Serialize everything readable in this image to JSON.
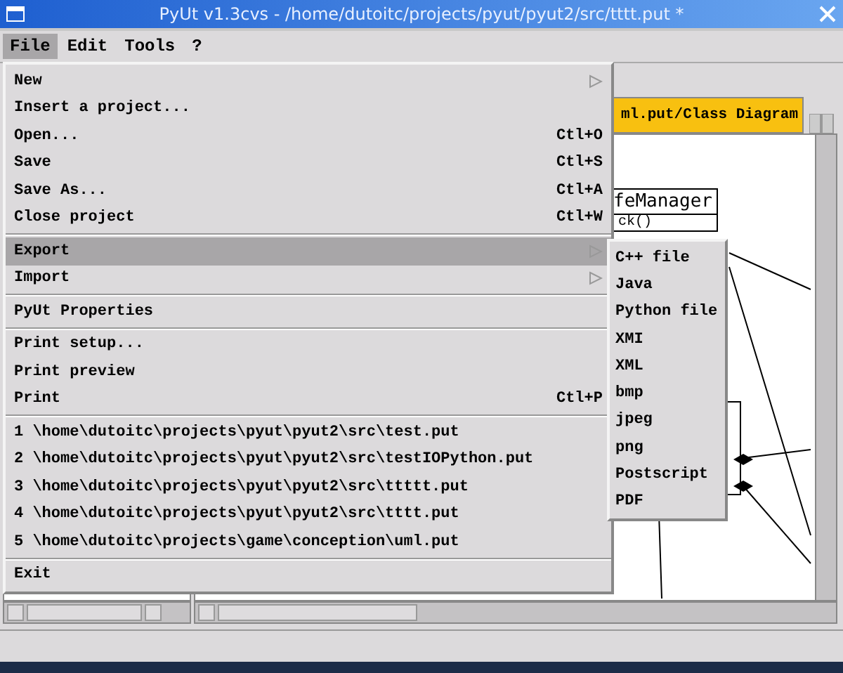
{
  "window": {
    "title": "PyUt v1.3cvs - /home/dutoitc/projects/pyut/pyut2/src/tttt.put *"
  },
  "menubar": [
    {
      "label": "File",
      "selected": true
    },
    {
      "label": "Edit",
      "selected": false
    },
    {
      "label": "Tools",
      "selected": false
    },
    {
      "label": "?",
      "selected": false
    }
  ],
  "file_menu": [
    {
      "kind": "submenu",
      "label": "New",
      "selected": false
    },
    {
      "kind": "item",
      "label": "Insert a project...",
      "selected": false
    },
    {
      "kind": "item",
      "label": "Open...",
      "shortcut": "Ctl+O",
      "selected": false
    },
    {
      "kind": "item",
      "label": "Save",
      "shortcut": "Ctl+S",
      "selected": false
    },
    {
      "kind": "item",
      "label": "Save As...",
      "shortcut": "Ctl+A",
      "selected": false
    },
    {
      "kind": "item",
      "label": "Close project",
      "shortcut": "Ctl+W",
      "selected": false
    },
    {
      "kind": "separator"
    },
    {
      "kind": "submenu",
      "label": "Export",
      "selected": true
    },
    {
      "kind": "submenu",
      "label": "Import",
      "selected": false
    },
    {
      "kind": "separator"
    },
    {
      "kind": "item",
      "label": "PyUt Properties",
      "selected": false
    },
    {
      "kind": "separator"
    },
    {
      "kind": "item",
      "label": "Print setup...",
      "selected": false
    },
    {
      "kind": "item",
      "label": "Print preview",
      "selected": false
    },
    {
      "kind": "item",
      "label": "Print",
      "shortcut": "Ctl+P",
      "selected": false
    },
    {
      "kind": "separator"
    },
    {
      "kind": "item",
      "label": "1 \\home\\dutoitc\\projects\\pyut\\pyut2\\src\\test.put",
      "selected": false
    },
    {
      "kind": "item",
      "label": "2 \\home\\dutoitc\\projects\\pyut\\pyut2\\src\\testIOPython.put",
      "selected": false
    },
    {
      "kind": "item",
      "label": "3 \\home\\dutoitc\\projects\\pyut\\pyut2\\src\\ttttt.put",
      "selected": false
    },
    {
      "kind": "item",
      "label": "4 \\home\\dutoitc\\projects\\pyut\\pyut2\\src\\tttt.put",
      "selected": false
    },
    {
      "kind": "item",
      "label": "5 \\home\\dutoitc\\projects\\game\\conception\\uml.put",
      "selected": false
    },
    {
      "kind": "separator"
    },
    {
      "kind": "item",
      "label": "Exit",
      "selected": false
    }
  ],
  "export_menu": [
    "C++ file",
    "Java",
    "Python file",
    "XMI",
    "XML",
    "bmp",
    "jpeg",
    "png",
    "Postscript",
    "PDF"
  ],
  "tab": {
    "label": "ml.put/Class Diagram",
    "selected": true
  },
  "diagram": {
    "class_name": "feManager",
    "method": "ck()"
  }
}
